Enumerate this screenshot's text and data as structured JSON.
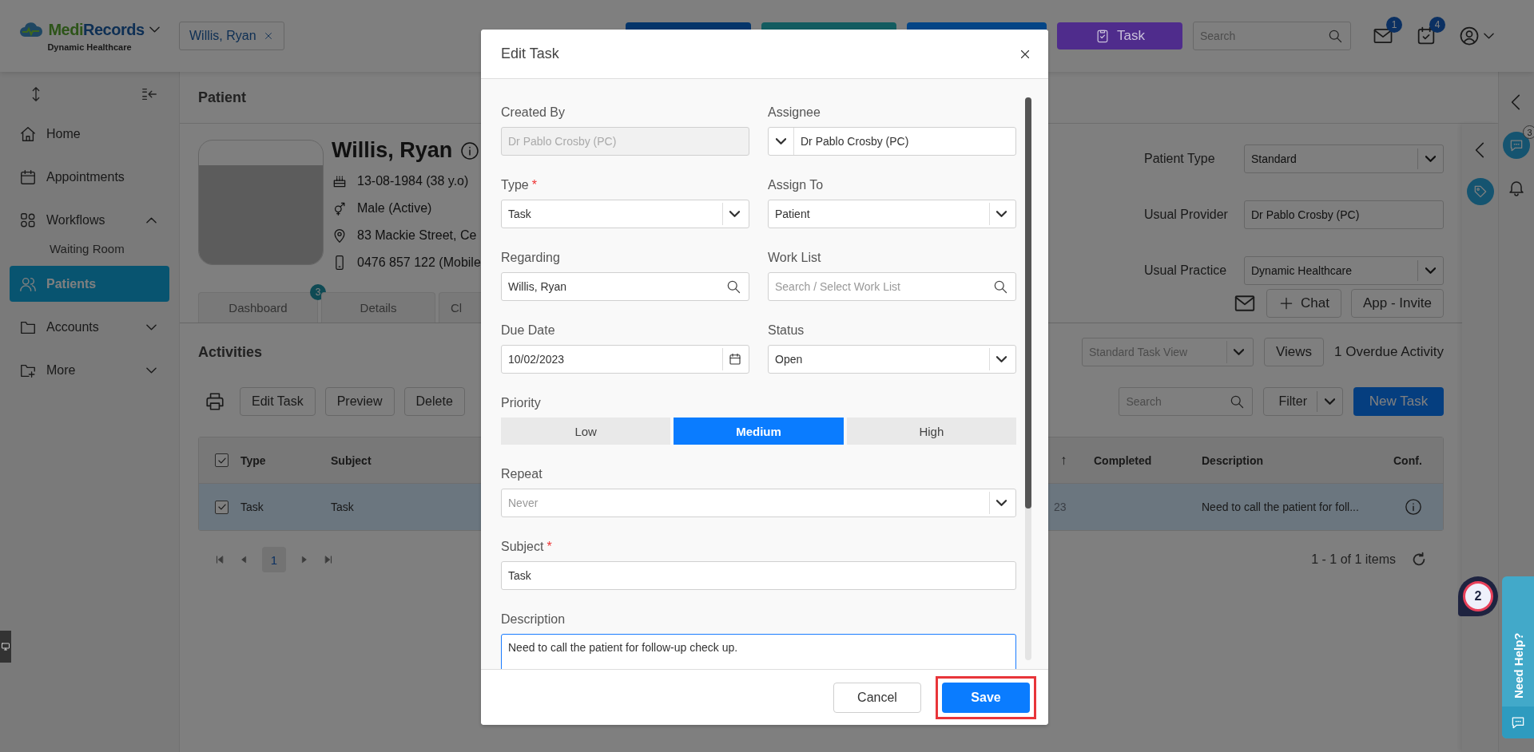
{
  "header": {
    "brand_prefix": "Medi",
    "brand_suffix": "Records",
    "brand_subtitle": "Dynamic Healthcare",
    "open_tab": "Willis, Ryan",
    "action_buttons": [
      {
        "color": "#05356a"
      },
      {
        "color": "#135c60"
      },
      {
        "color": "#044586"
      },
      {
        "color": "#4f2c8c",
        "label": "Task"
      }
    ],
    "search": {
      "placeholder": "Search"
    },
    "mail_badge": "1",
    "tasks_badge": "4"
  },
  "sidebar": {
    "items": [
      {
        "label": "Home",
        "selected": false
      },
      {
        "label": "Appointments",
        "selected": false
      },
      {
        "label": "Workflows",
        "selected": false,
        "expanded": true,
        "children": [
          {
            "label": "Waiting Room",
            "selected": false
          }
        ]
      },
      {
        "label": "Patients",
        "selected": true
      },
      {
        "label": "Accounts",
        "selected": false,
        "expanded": false
      },
      {
        "label": "More",
        "selected": false,
        "expanded": false
      }
    ]
  },
  "page_title": "Patient",
  "patient": {
    "name": "Willis, Ryan",
    "dob": "13-08-1984 (38 y.o)",
    "gender": "Male (Active)",
    "address": "83 Mackie Street, Ce",
    "phone": "0476 857 122 (Mobile",
    "fields": [
      {
        "label": "Patient Type",
        "kind": "select",
        "value": "Standard"
      },
      {
        "label": "Usual Provider",
        "kind": "text",
        "value": "Dr Pablo Crosby (PC)"
      },
      {
        "label": "Usual Practice",
        "kind": "select",
        "value": "Dynamic Healthcare"
      }
    ]
  },
  "tabs": [
    {
      "label": "Dashboard",
      "badge": "3"
    },
    {
      "label": "Details"
    },
    {
      "label": "Cl"
    }
  ],
  "contact_actions": [
    {
      "label": "Chat"
    },
    {
      "label": "App - Invite"
    }
  ],
  "activities": {
    "title": "Activities",
    "view_select": {
      "placeholder": "Standard Task View"
    },
    "views_button": "Views",
    "overdue": "1 Overdue Activity",
    "toolbar": [
      "Edit Task",
      "Preview",
      "Delete"
    ],
    "search": {
      "placeholder": "Search"
    },
    "filter_button": "Filter",
    "new_task_button": "New Task",
    "table": {
      "header_checked": true,
      "columns": [
        {
          "label": "Type"
        },
        {
          "label": "Subject"
        },
        {
          "sort_mark": "↑"
        },
        {
          "label": "Completed"
        },
        {
          "label": "Description"
        },
        {
          "label": "Conf."
        }
      ],
      "rows": [
        {
          "selected": true,
          "checked": true,
          "type": "Task",
          "subject": "Task",
          "column_3": "23",
          "description": "Need to call the patient for foll..."
        }
      ]
    },
    "pagination": {
      "pages": [
        {
          "label": "1",
          "selected": true
        }
      ],
      "summary": "1 - 1 of 1 items"
    }
  },
  "right_rail": {
    "chat_badge": "3"
  },
  "modal": {
    "title": "Edit Task",
    "fields": [
      {
        "label": "Created By",
        "kind": "text",
        "value": "Dr Pablo Crosby (PC)",
        "disabled": true
      },
      {
        "label": "Assignee",
        "kind": "combo",
        "value": "Dr Pablo Crosby (PC)",
        "disabled": false
      },
      {
        "label": "Type",
        "required_mark": "*",
        "kind": "select",
        "value": "Task",
        "disabled": false
      },
      {
        "label": "Assign To",
        "kind": "select",
        "value": "Patient",
        "disabled": false
      },
      {
        "label": "Regarding",
        "kind": "search",
        "value": "Willis, Ryan",
        "disabled": false
      },
      {
        "label": "Work List",
        "kind": "search",
        "placeholder": "Search / Select Work List",
        "disabled": false
      },
      {
        "label": "Due Date",
        "kind": "date",
        "value": "10/02/2023",
        "disabled": false
      },
      {
        "label": "Status",
        "kind": "select",
        "value": "Open",
        "disabled": false
      }
    ],
    "priority": {
      "label": "Priority",
      "options": [
        {
          "label": "Low",
          "selected": false
        },
        {
          "label": "Medium",
          "selected": true
        },
        {
          "label": "High",
          "selected": false
        }
      ]
    },
    "repeat": {
      "label": "Repeat",
      "placeholder": "Never"
    },
    "subject": {
      "label": "Subject",
      "required_mark": "*",
      "value": "Task",
      "focused": false
    },
    "description": {
      "label": "Description",
      "value": "Need to call the patient for follow-up check up.",
      "focused": true
    },
    "buttons": [
      {
        "label": "Cancel",
        "kind": "secondary",
        "highlighted": false
      },
      {
        "label": "Save",
        "kind": "primary",
        "highlighted": true
      }
    ]
  },
  "floating_badge": "2",
  "help_tab": "Need Help?"
}
